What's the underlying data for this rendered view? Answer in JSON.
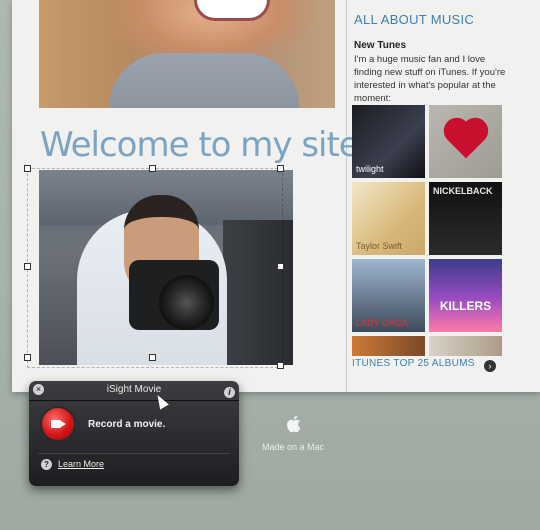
{
  "page": {
    "welcome_title": "Welcome to my site!"
  },
  "sidebar": {
    "title": "ALL ABOUT MUSIC",
    "subtitle": "New Tunes",
    "body": "I'm a huge music fan and I love finding new stuff on iTunes. If you're interested in what's popular at the moment:",
    "albums": [
      {
        "label": "twilight"
      },
      {
        "label": ""
      },
      {
        "label": "Taylor Swift"
      },
      {
        "label": "NICKELBACK"
      },
      {
        "label": "LADY GAGA"
      },
      {
        "label": "KILLERS"
      },
      {
        "label": ""
      },
      {
        "label": ""
      }
    ],
    "top_albums_link": "ITUNES TOP 25 ALBUMS"
  },
  "popover": {
    "title": "iSight Movie",
    "record_label": "Record a movie.",
    "learn_more": "Learn More"
  },
  "footer": {
    "made_on_mac": "Made on a Mac"
  },
  "colors": {
    "accent_blue": "#3d7fb3",
    "record_red": "#d31717"
  }
}
